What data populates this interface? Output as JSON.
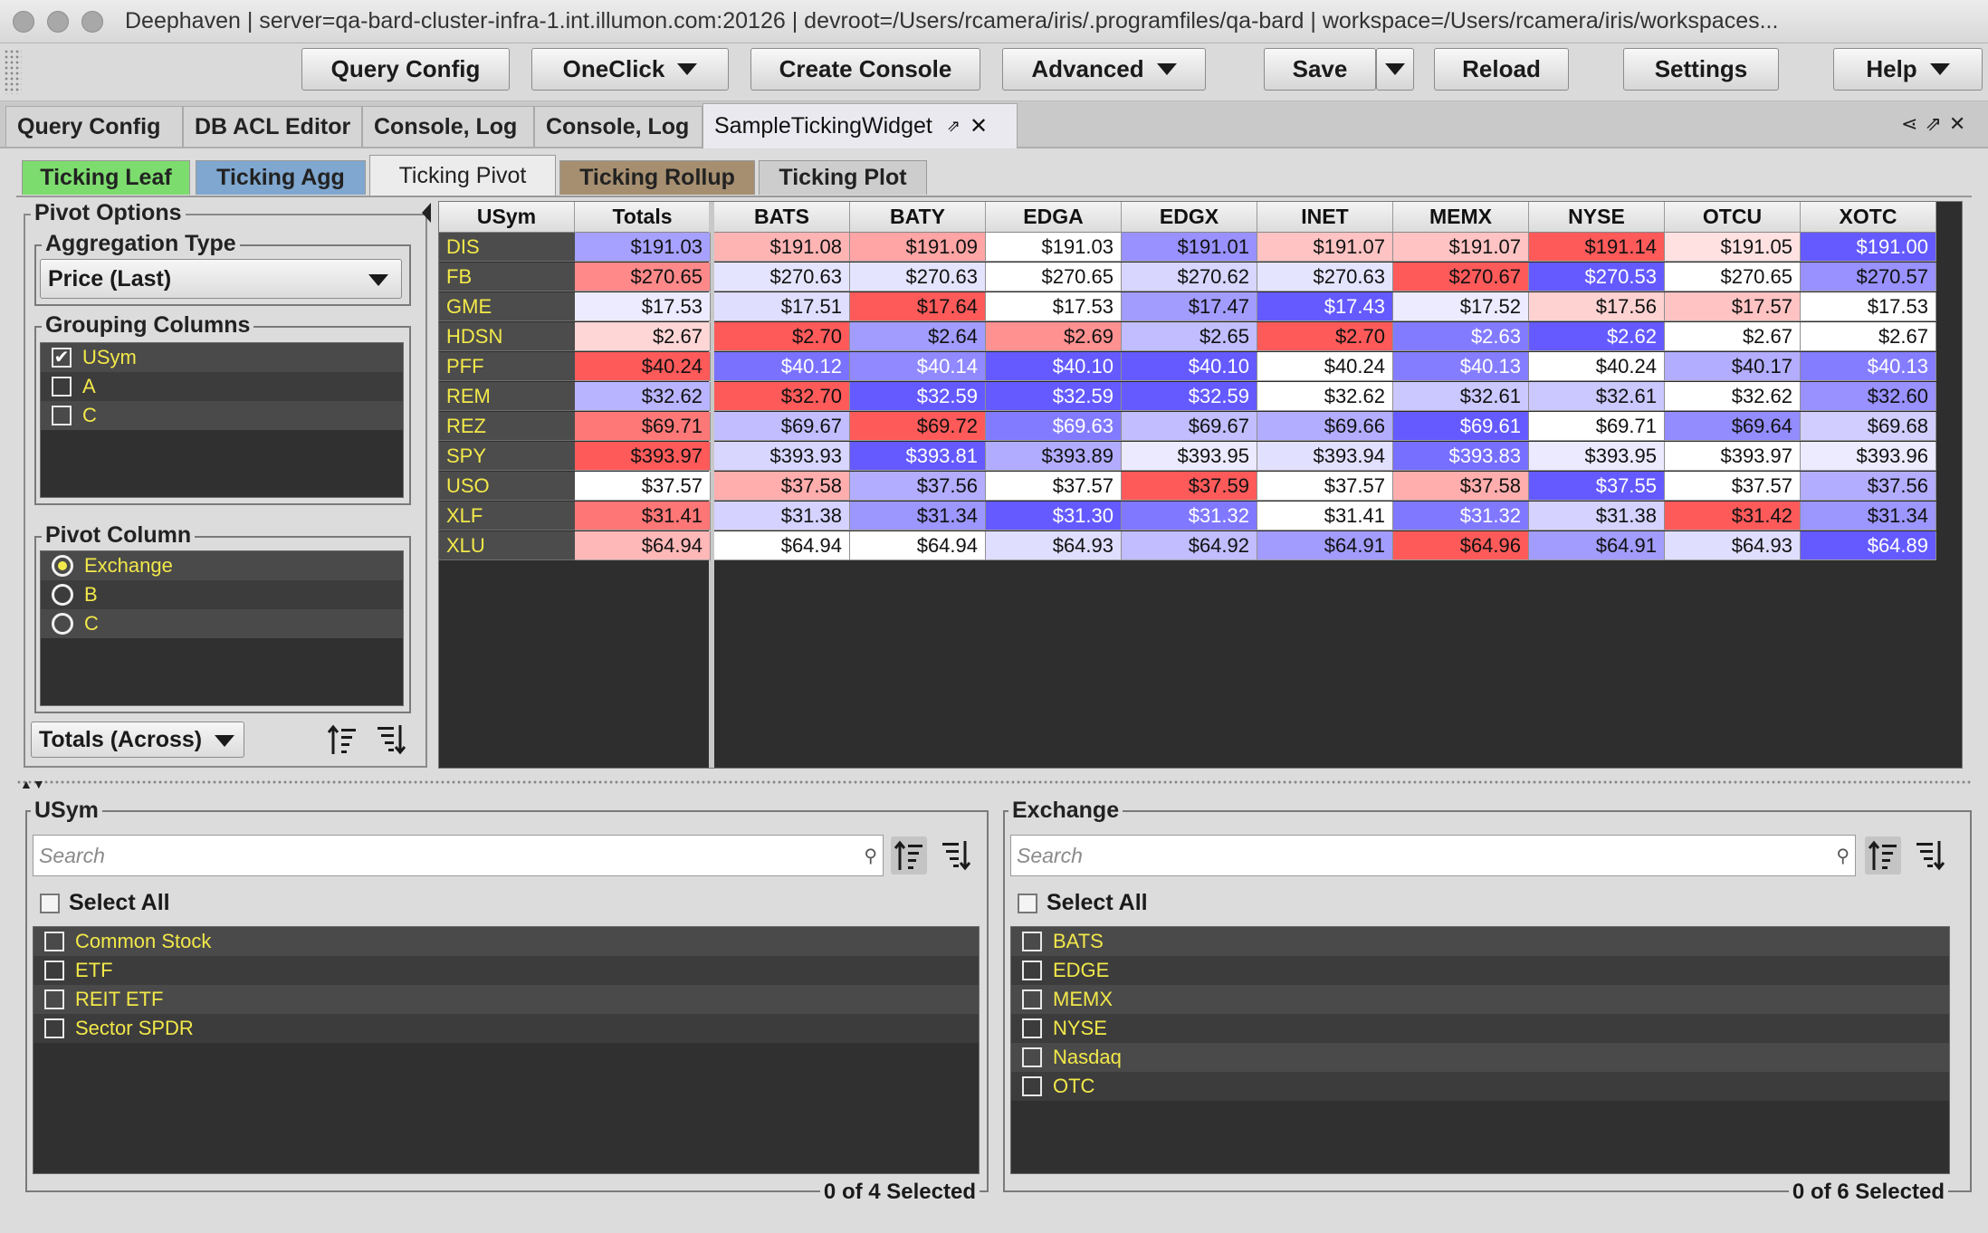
{
  "window": {
    "title": "Deephaven  | server=qa-bard-cluster-infra-1.int.illumon.com:20126 | devroot=/Users/rcamera/iris/.programfiles/qa-bard | workspace=/Users/rcamera/iris/workspaces..."
  },
  "toolbar": {
    "query_config": "Query Config",
    "oneclick": "OneClick",
    "create_console": "Create Console",
    "advanced": "Advanced",
    "save": "Save",
    "reload": "Reload",
    "settings": "Settings",
    "help": "Help"
  },
  "doc_tabs": [
    "Query Config",
    "DB ACL Editor",
    "Console, Log",
    "Console, Log",
    "SampleTickingWidget"
  ],
  "inner_tabs": [
    {
      "label": "Ticking Leaf",
      "color": "#7ddc6e"
    },
    {
      "label": "Ticking Agg",
      "color": "#7fa7cf"
    },
    {
      "label": "Ticking Pivot",
      "color": "#ececec"
    },
    {
      "label": "Ticking Rollup",
      "color": "#a68f70"
    },
    {
      "label": "Ticking Plot",
      "color": "#cdcdcd"
    }
  ],
  "pivot_options": {
    "title": "Pivot Options",
    "aggregation_type_label": "Aggregation Type",
    "aggregation_type_value": "Price (Last)",
    "grouping_columns_label": "Grouping Columns",
    "grouping_columns": [
      {
        "label": "USym",
        "checked": true
      },
      {
        "label": "A",
        "checked": false
      },
      {
        "label": "C",
        "checked": false
      }
    ],
    "pivot_column_label": "Pivot Column",
    "pivot_columns": [
      {
        "label": "Exchange",
        "selected": true
      },
      {
        "label": "B",
        "selected": false
      },
      {
        "label": "C",
        "selected": false
      }
    ],
    "totals_mode": "Totals (Across)"
  },
  "grid": {
    "headers": [
      "USym",
      "Totals",
      "BATS",
      "BATY",
      "EDGA",
      "EDGX",
      "INET",
      "MEMX",
      "NYSE",
      "OTCU",
      "XOTC"
    ],
    "rows": [
      {
        "sym": "DIS",
        "cells": [
          "$191.03",
          "$191.08",
          "$191.09",
          "$191.03",
          "$191.01",
          "$191.07",
          "$191.07",
          "$191.14",
          "$191.05",
          "$191.00"
        ]
      },
      {
        "sym": "FB",
        "cells": [
          "$270.65",
          "$270.63",
          "$270.63",
          "$270.65",
          "$270.62",
          "$270.63",
          "$270.67",
          "$270.53",
          "$270.65",
          "$270.57"
        ]
      },
      {
        "sym": "GME",
        "cells": [
          "$17.53",
          "$17.51",
          "$17.64",
          "$17.53",
          "$17.47",
          "$17.43",
          "$17.52",
          "$17.56",
          "$17.57",
          "$17.53"
        ]
      },
      {
        "sym": "HDSN",
        "cells": [
          "$2.67",
          "$2.70",
          "$2.64",
          "$2.69",
          "$2.65",
          "$2.70",
          "$2.63",
          "$2.62",
          "$2.67",
          "$2.67"
        ]
      },
      {
        "sym": "PFF",
        "cells": [
          "$40.24",
          "$40.12",
          "$40.14",
          "$40.10",
          "$40.10",
          "$40.24",
          "$40.13",
          "$40.24",
          "$40.17",
          "$40.13"
        ]
      },
      {
        "sym": "REM",
        "cells": [
          "$32.62",
          "$32.70",
          "$32.59",
          "$32.59",
          "$32.59",
          "$32.62",
          "$32.61",
          "$32.61",
          "$32.62",
          "$32.60"
        ]
      },
      {
        "sym": "REZ",
        "cells": [
          "$69.71",
          "$69.67",
          "$69.72",
          "$69.63",
          "$69.67",
          "$69.66",
          "$69.61",
          "$69.71",
          "$69.64",
          "$69.68"
        ]
      },
      {
        "sym": "SPY",
        "cells": [
          "$393.97",
          "$393.93",
          "$393.81",
          "$393.89",
          "$393.95",
          "$393.94",
          "$393.83",
          "$393.95",
          "$393.97",
          "$393.96"
        ]
      },
      {
        "sym": "USO",
        "cells": [
          "$37.57",
          "$37.58",
          "$37.56",
          "$37.57",
          "$37.59",
          "$37.57",
          "$37.58",
          "$37.55",
          "$37.57",
          "$37.56"
        ]
      },
      {
        "sym": "XLF",
        "cells": [
          "$31.41",
          "$31.38",
          "$31.34",
          "$31.30",
          "$31.32",
          "$31.41",
          "$31.32",
          "$31.38",
          "$31.42",
          "$31.34"
        ]
      },
      {
        "sym": "XLU",
        "cells": [
          "$64.94",
          "$64.94",
          "$64.94",
          "$64.93",
          "$64.92",
          "$64.91",
          "$64.96",
          "$64.91",
          "$64.93",
          "$64.89"
        ]
      }
    ]
  },
  "filters": {
    "usym": {
      "title": "USym",
      "search_placeholder": "Search",
      "select_all": "Select All",
      "items": [
        "Common Stock",
        "ETF",
        "REIT ETF",
        "Sector SPDR"
      ],
      "count": "0 of 4 Selected"
    },
    "exchange": {
      "title": "Exchange",
      "search_placeholder": "Search",
      "select_all": "Select All",
      "items": [
        "BATS",
        "EDGE",
        "MEMX",
        "NYSE",
        "Nasdaq",
        "OTC"
      ],
      "count": "0 of 6 Selected"
    }
  }
}
